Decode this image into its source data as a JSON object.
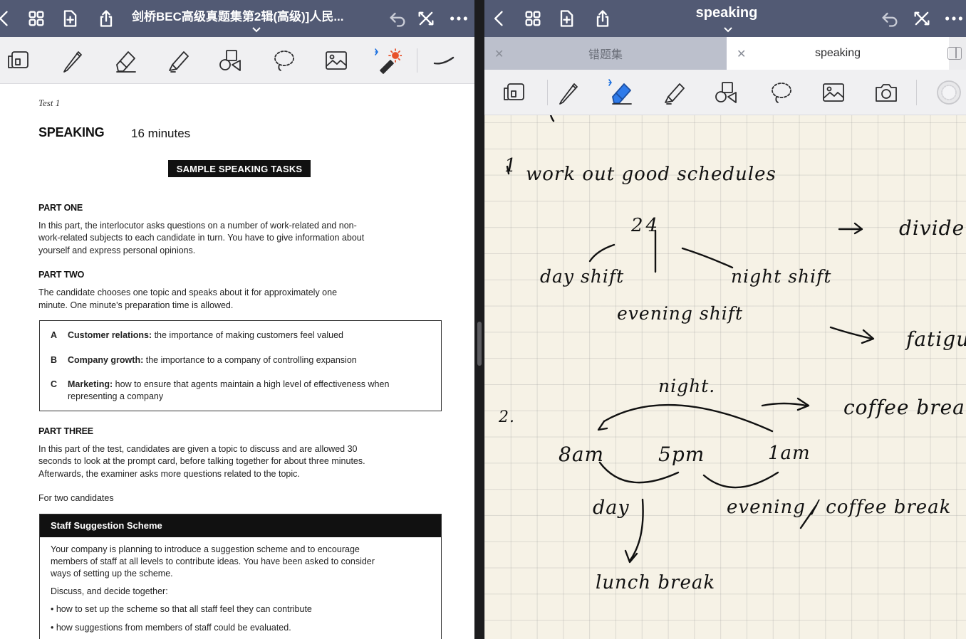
{
  "left_pane": {
    "navbar": {
      "title": "剑桥BEC高级真题集第2辑(高级)]人民...",
      "icons": [
        "chevron-left-icon",
        "grid-icon",
        "add-page-icon",
        "share-icon",
        "undo-icon",
        "close-x-icon",
        "more-icon"
      ]
    },
    "toolbar": {
      "tools": [
        "page-layout-icon",
        "pen-icon",
        "eraser-icon",
        "highlighter-icon",
        "shapes-icon",
        "lasso-icon",
        "image-icon",
        "laser-pointer-icon",
        "stroke-preview-icon"
      ]
    },
    "page": {
      "test_label": "Test 1",
      "section_title": "SPEAKING",
      "duration": "16 minutes",
      "banner": "SAMPLE SPEAKING TASKS",
      "part_one": {
        "heading": "PART ONE",
        "lines": [
          "In this part, the interlocutor asks questions on a number of work-related and non-",
          "work-related subjects to each candidate in turn. You have to give information about",
          "yourself and express personal opinions."
        ]
      },
      "part_two": {
        "heading": "PART TWO",
        "lines": [
          "The candidate chooses one topic and speaks about it for approximately one",
          "minute. One minute's preparation time is allowed."
        ]
      },
      "tasks": [
        {
          "letter": "A",
          "title": "Customer relations:",
          "text": " the importance of making customers feel valued"
        },
        {
          "letter": "B",
          "title": "Company growth:",
          "text": " the importance to a company of controlling expansion"
        },
        {
          "letter": "C",
          "title": "Marketing:",
          "text": " how to ensure that agents maintain a high level of effectiveness when",
          "text2": "representing a company"
        }
      ],
      "part_three": {
        "heading": "PART THREE",
        "lines": [
          "In this part of the test, candidates are given a topic to discuss and are allowed 30",
          "seconds to look at the prompt card, before talking together for about three minutes.",
          "Afterwards, the examiner asks more questions related to the topic."
        ]
      },
      "for_two": "For two candidates",
      "scheme": {
        "title": "Staff Suggestion Scheme",
        "intro": [
          "Your company is planning to introduce a suggestion scheme and to encourage",
          "members of staff at all levels to contribute ideas. You have been asked to consider",
          "ways of setting up the scheme."
        ],
        "discuss": "Discuss, and decide together:",
        "bullets": [
          "how to set up the scheme so that all staff feel they can contribute",
          "how suggestions from members of staff could be evaluated."
        ]
      }
    }
  },
  "right_pane": {
    "navbar": {
      "title": "speaking",
      "icons": [
        "chevron-left-icon",
        "grid-icon",
        "add-page-icon",
        "share-icon",
        "undo-icon",
        "close-x-icon",
        "more-icon"
      ]
    },
    "tabs": [
      {
        "label": "错题集",
        "active": false
      },
      {
        "label": "speaking",
        "active": true
      }
    ],
    "toolbar": {
      "tools": [
        "page-layout-icon",
        "pen-icon",
        "eraser-icon",
        "highlighter-icon",
        "shapes-icon",
        "lasso-icon",
        "image-icon",
        "camera-icon",
        "color-swatch-icon"
      ]
    },
    "notes": {
      "item1_number": "1",
      "item1_heading": "work out good schedules",
      "hours_24": "24",
      "arrow_divide": "->",
      "divide": "divide",
      "day_shift": "day shift",
      "night_shift": "night shift",
      "evening_shift": "evening shift",
      "arrow_fatigue": "->",
      "fatigue": "fatigu",
      "item2_number": "2.",
      "night_label": "night.",
      "coffee_break_top": "coffee brea",
      "time_8am": "8am",
      "time_5pm": "5pm",
      "time_1am": "1am",
      "day": "day",
      "evening_coffee": "evening / coffee break",
      "lunch_break": "lunch break"
    }
  }
}
